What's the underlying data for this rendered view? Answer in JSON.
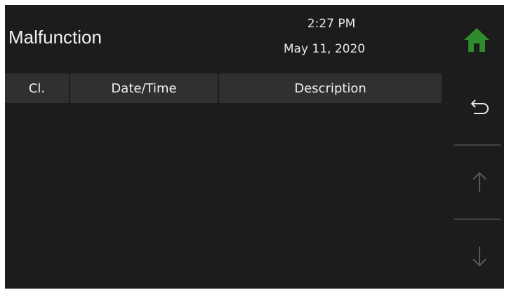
{
  "header": {
    "title": "Malfunction",
    "time": "2:27 PM",
    "date": "May 11, 2020"
  },
  "table": {
    "columns": [
      "Cl.",
      "Date/Time",
      "Description"
    ],
    "rows": []
  },
  "sidebar": {
    "home_icon": "home-icon",
    "back_icon": "return-arrow-icon",
    "up_icon": "arrow-up-icon",
    "down_icon": "arrow-down-icon"
  },
  "colors": {
    "background": "#1c1c1c",
    "header_row": "#303030",
    "home_accent": "#2e8b2e",
    "disabled_arrow": "#5a5a5a"
  }
}
